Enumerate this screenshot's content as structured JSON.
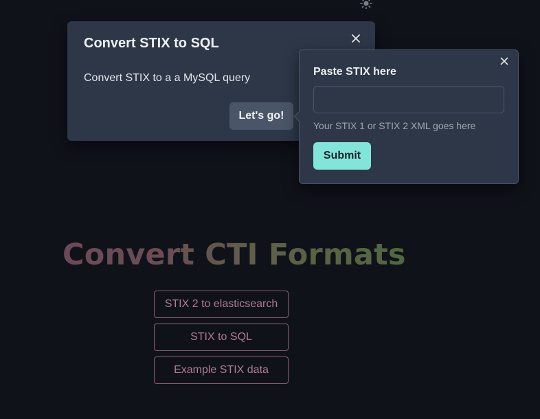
{
  "app": {
    "hero_title": "Convert CTI Formats",
    "theme_icon": "sun-icon"
  },
  "nav": {
    "buttons": [
      "STIX 2 to elasticsearch",
      "STIX to SQL",
      "Example STIX data"
    ]
  },
  "dialog": {
    "title": "Convert STIX to SQL",
    "body": "Convert STIX to a a MySQL query",
    "action_label": "Let's go!",
    "close_icon": "close-icon"
  },
  "popover": {
    "label": "Paste STIX here",
    "input_value": "",
    "input_placeholder": "",
    "help_text": "Your STIX 1 or STIX 2 XML goes here",
    "submit_label": "Submit",
    "close_icon": "close-icon"
  },
  "colors": {
    "background": "#10121a",
    "panel": "#2d3748",
    "accent": "#81e6d9",
    "outline_button": "#8a5d6f"
  }
}
